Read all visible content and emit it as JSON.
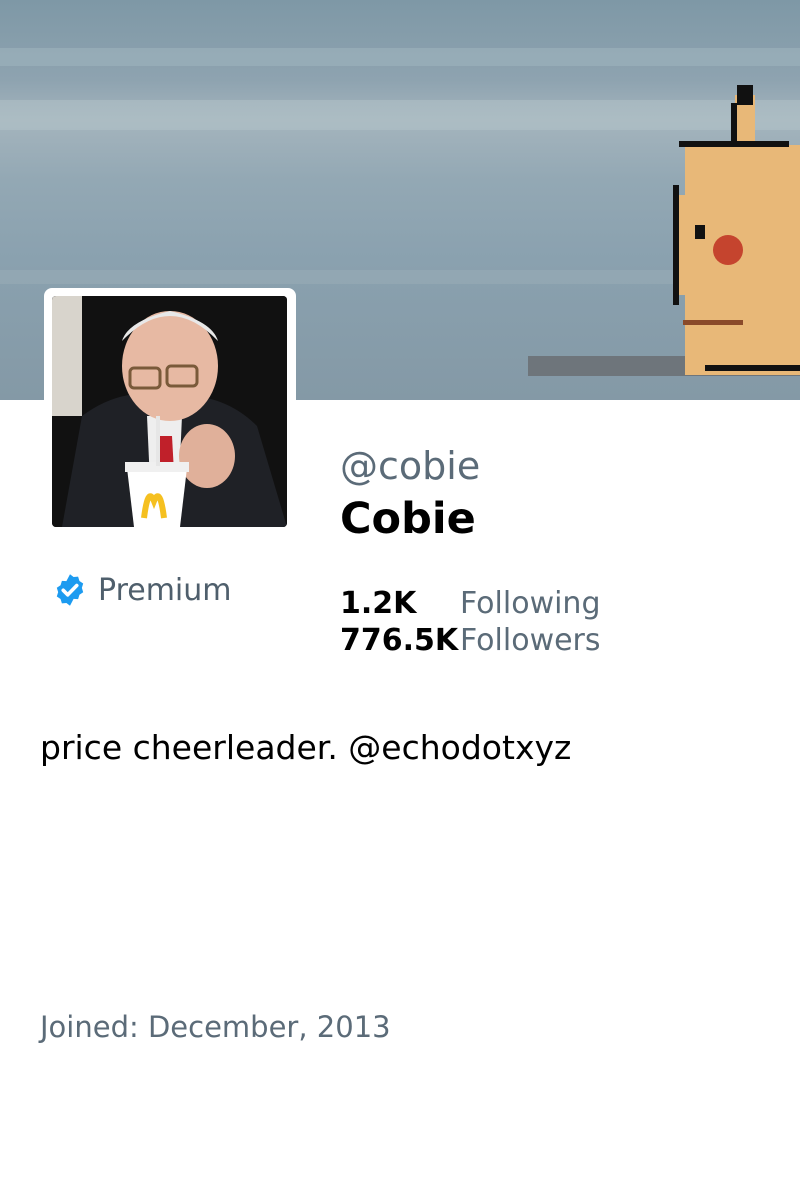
{
  "profile": {
    "handle": "@cobie",
    "display_name": "Cobie",
    "premium_label": "Premium",
    "following_count": "1.2K",
    "following_label": "Following",
    "followers_count": "776.5K",
    "followers_label": "Followers",
    "bio": "price cheerleader. @echodotxyz",
    "joined": "Joined: December, 2013"
  },
  "icons": {
    "verified": "verified-badge-icon"
  },
  "colors": {
    "verified_blue": "#1d9bf0",
    "secondary_text": "#5b6b78",
    "primary_text": "#000000"
  }
}
